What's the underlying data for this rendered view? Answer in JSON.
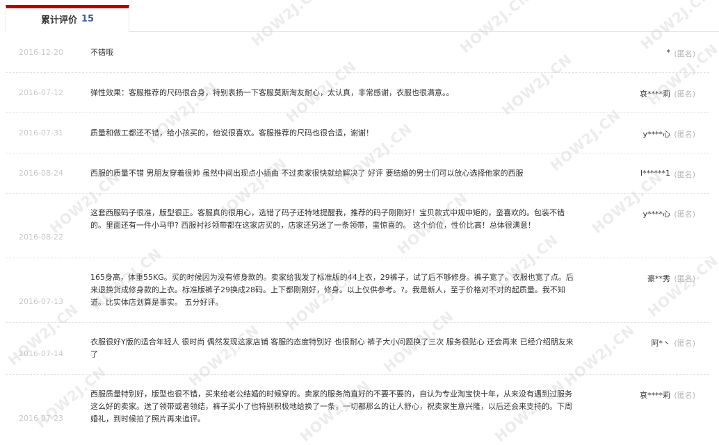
{
  "tab": {
    "label": "累计评价",
    "count": "15"
  },
  "reviews": [
    {
      "date": "2016-12-20",
      "content": "不错哦",
      "user": "*",
      "anon": "(匿名)"
    },
    {
      "date": "2016-07-12",
      "content": "弹性效果：客服推荐的尺码很合身，特别表扬一下客服莫斯淘友耐心，太认真，非常感谢，衣服也很满意。。",
      "user": "哀****莉",
      "anon": "(匿名)"
    },
    {
      "date": "2016-07-31",
      "content": "质量和做工都还不错，给小孩买的，他说很喜欢。客服推荐的尺码也很合适，谢谢！",
      "user": "y****心",
      "anon": "(匿名)"
    },
    {
      "date": "2016-08-24",
      "content": "西服的质量不错 男朋友穿着很帅 虽然中间出现点小插曲 不过卖家很快就给解决了 好评 要结婚的男士们可以放心选择他家的西服",
      "user": "l******1",
      "anon": "(匿名)"
    },
    {
      "date": "2016-08-22",
      "content": "这套西服码子很准，版型很正。客服真的很用心，选错了码子还特地提醒我，推荐的码子刚刚好！宝贝款式中规中矩的，蛮喜欢的。包装不错的。里面还有一件小马甲? 西服衬衫领带都在这家店买的，店家还另送了一条领带，蛮惊喜的。 这个价位，性价比高！总体很满意！",
      "user": "y****心",
      "anon": "(匿名)"
    },
    {
      "date": "2016-07-13",
      "content": "165身高，体重55KG。买的时候因为没有修身款的。卖家给我发了标准版的44上衣，29裤子，试了后不够修身。裤子宽了。衣服也宽了点。后来退换货成修身款的上衣。标准版裤子29换成28码。上下都刚刚好，修身。以上仅供参考。?。我是新人，至于价格对不对的起质量。我不知道。比实体店划算是事实。 五分好评。",
      "user": "豪**秀",
      "anon": "(匿名)"
    },
    {
      "date": "2016-07-14",
      "content": "衣服很好Y版的适合年轻人 很时尚 偶然发现这家店铺 客服的态度特别好 也很耐心 裤子大小问题换了三次 服务很贴心 还会再来 已经介绍朋友来了",
      "user": "阿*丶",
      "anon": "(匿名)"
    },
    {
      "date": "2016-07-23",
      "content": "西服质量特别好，版型也很不错，买来给老公结婚的时候穿的。卖家的服务简直好的不要不要的，自认为专业淘宝快十年，从来没有遇到过服务这么好的卖家。送了领带或者领结，裤子买小了也特别积极地给换了一条，一切都那么的让人舒心，祝卖家生意兴隆，以后还会来支持的。下周婚礼，到时候拍了照片再来追评。",
      "user": "哀****莉",
      "anon": "(匿名)"
    }
  ],
  "watermark": "HOW2J.CN"
}
